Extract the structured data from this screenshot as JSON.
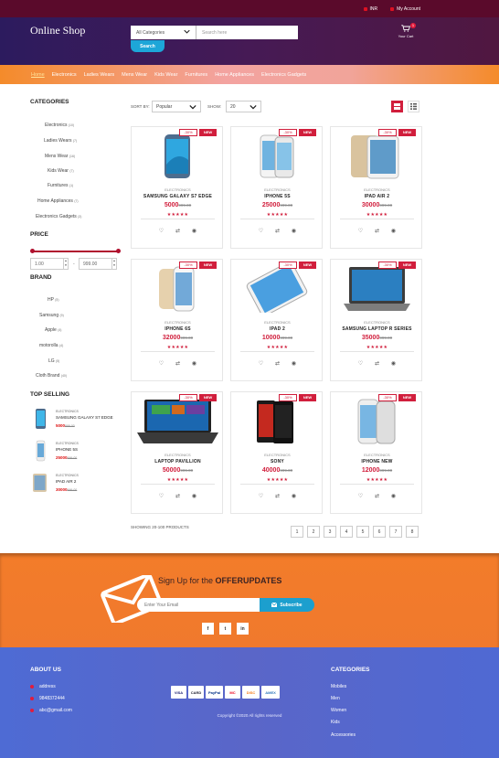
{
  "topbar": {
    "currency": "INR",
    "account": "My Account"
  },
  "header": {
    "logo": "Online Shop",
    "category_select": "All Categories",
    "search_placeholder": "Search here",
    "search_button": "Search",
    "cart_label": "Your Cart",
    "cart_count": "1"
  },
  "nav": [
    "Home",
    "Electronics",
    "Ladies Wears",
    "Mens Wear",
    "Kids Wear",
    "Furnitures",
    "Home Appliances",
    "Electronics Gadgets"
  ],
  "sidebar": {
    "categories_title": "CATEGORIES",
    "categories": [
      {
        "name": "Electronics",
        "count": "(10)"
      },
      {
        "name": "Ladies Wears",
        "count": "(7)"
      },
      {
        "name": "Mens Wear",
        "count": "(16)"
      },
      {
        "name": "Kids Wear",
        "count": "(7)"
      },
      {
        "name": "Furnitures",
        "count": "(1)"
      },
      {
        "name": "Home Appliances",
        "count": "(7)"
      },
      {
        "name": "Electronics Gadgets",
        "count": "(3)"
      }
    ],
    "price_title": "PRICE",
    "price_min": "1.00",
    "price_max": "999.00",
    "brand_title": "BRAND",
    "brands": [
      {
        "name": "HP",
        "count": "(5)"
      },
      {
        "name": "Samsung",
        "count": "(9)"
      },
      {
        "name": "Apple",
        "count": "(4)"
      },
      {
        "name": "motorolla",
        "count": "(4)"
      },
      {
        "name": "LG",
        "count": "(5)"
      },
      {
        "name": "Cloth Brand",
        "count": "(40)"
      }
    ],
    "top_selling_title": "TOP SELLING",
    "top_selling": [
      {
        "category": "Electronics",
        "name": "SAMSUNG GALAXY S7 EDGE",
        "price": "5000",
        "old": "999.00"
      },
      {
        "category": "Electronics",
        "name": "IPHONE 5S",
        "price": "25000",
        "old": "999.00"
      },
      {
        "category": "Electronics",
        "name": "IPAD AIR 2",
        "price": "30000",
        "old": "999.00"
      }
    ]
  },
  "toolbar": {
    "sort_label": "SORT BY:",
    "sort_value": "Popular",
    "show_label": "SHOW:",
    "show_value": "20"
  },
  "badges": {
    "discount": "-30%",
    "new": "NEW"
  },
  "products": [
    {
      "category": "Electronics",
      "name": "SAMSUNG GALAXY S7 EDGE",
      "price": "5000",
      "old": "999.00",
      "rating": "★★★★★"
    },
    {
      "category": "Electronics",
      "name": "IPHONE 5S",
      "price": "25000",
      "old": "999.00",
      "rating": "★★★★★"
    },
    {
      "category": "Electronics",
      "name": "IPAD AIR 2",
      "price": "30000",
      "old": "999.00",
      "rating": "★★★★★"
    },
    {
      "category": "Electronics",
      "name": "IPHONE 6S",
      "price": "32000",
      "old": "999.00",
      "rating": "★★★★★"
    },
    {
      "category": "Electronics",
      "name": "IPAD 2",
      "price": "10000",
      "old": "999.00",
      "rating": "★★★★★"
    },
    {
      "category": "Electronics",
      "name": "SAMSUNG LAPTOP R SERIES",
      "price": "35000",
      "old": "999.00",
      "rating": "★★★★★"
    },
    {
      "category": "Electronics",
      "name": "LAPTOP PAVILLION",
      "price": "50000",
      "old": "999.00",
      "rating": "★★★★★"
    },
    {
      "category": "Electronics",
      "name": "SONY",
      "price": "40000",
      "old": "999.00",
      "rating": "★★★★★"
    },
    {
      "category": "Electronics",
      "name": "IPHONE NEW",
      "price": "12000",
      "old": "999.00",
      "rating": "★★★★★"
    }
  ],
  "showing": "SHOWING 20-100 PRODUCTS",
  "pagination": [
    "1",
    "2",
    "3",
    "4",
    "5",
    "6",
    "7",
    "8"
  ],
  "newsletter": {
    "title_prefix": "Sign Up for the ",
    "title_bold": "OFFERUPDATES",
    "email_placeholder": "Enter Your Email",
    "subscribe": "Subscribe"
  },
  "social": [
    "f",
    "t",
    "in"
  ],
  "footer": {
    "about_title": "ABOUT US",
    "address": "address",
    "phone": "9848372444",
    "email": "abc@gmail.com",
    "payments": [
      "VISA",
      "CARD",
      "PayPal",
      "MC",
      "DISC",
      "AMEX"
    ],
    "copyright": "Copyright ©2020 All rights reserved",
    "categories_title": "CATEGORIES",
    "categories": [
      "Mobiles",
      "Men",
      "Women",
      "Kids",
      "Accessories"
    ]
  },
  "colors": {
    "accent": "#d11e3c",
    "header": "#461a55",
    "nav": "#f48b2a",
    "footer": "#5066d0",
    "button": "#1da6d8"
  }
}
